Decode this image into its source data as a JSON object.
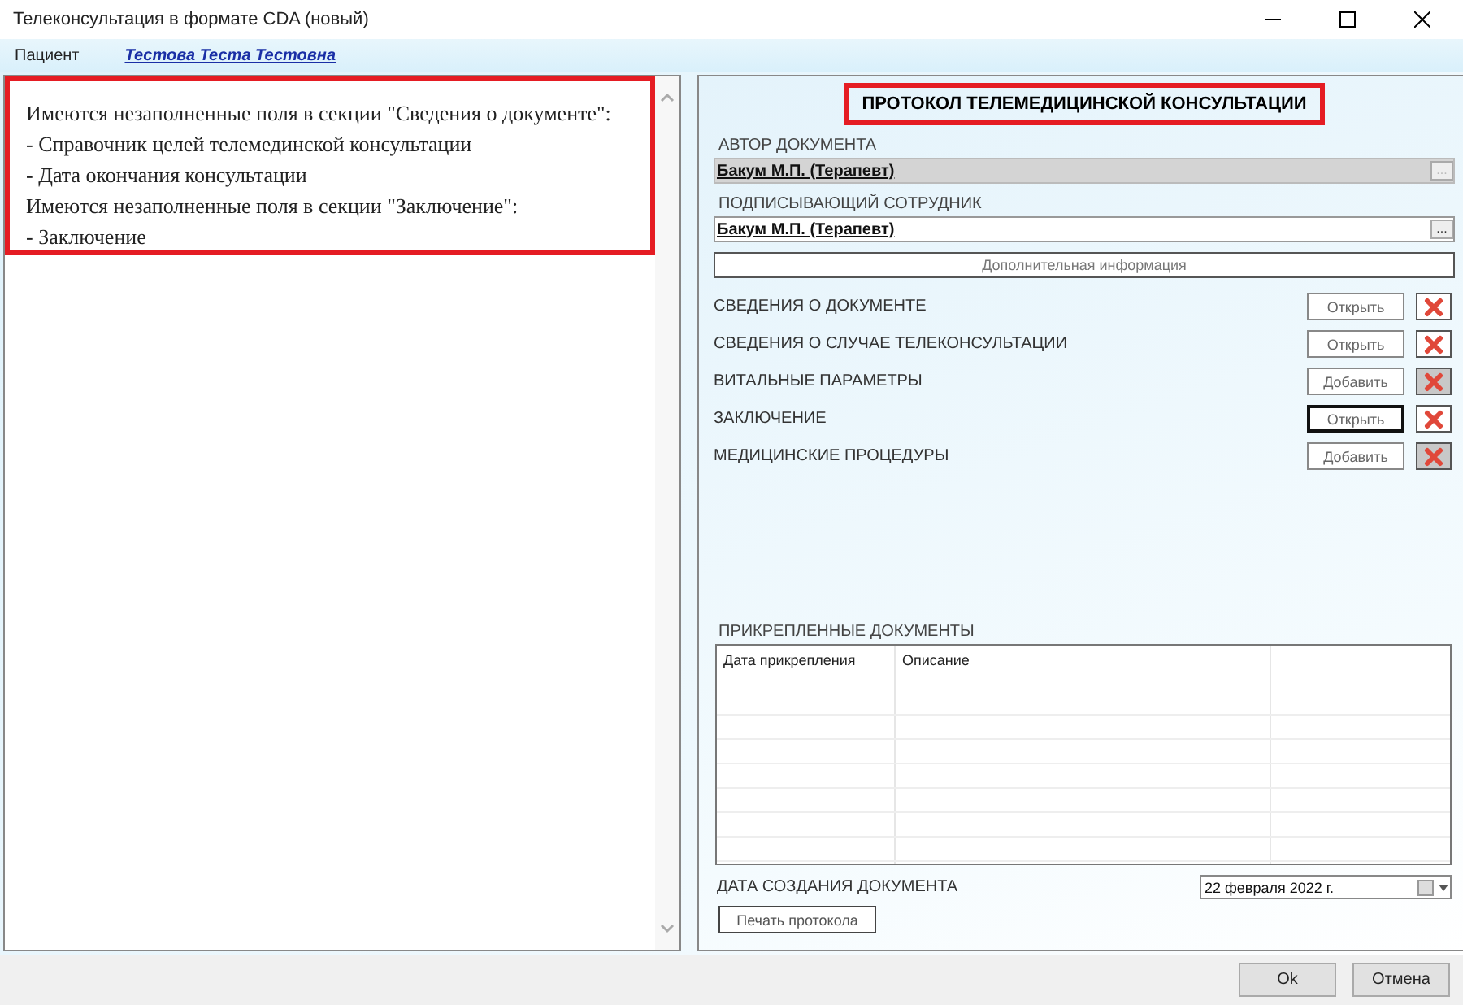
{
  "window": {
    "title": "Телеконсультация в формате CDA (новый)"
  },
  "patient": {
    "label": "Пациент",
    "name": "Тестова Теста Тестовна"
  },
  "messages": [
    "Имеются незаполненные поля в секции \"Сведения о документе\":",
    "- Справочник целей телемединской консультации",
    "- Дата окончания консультации",
    "Имеются незаполненные поля в секции \"Заключение\":",
    "- Заключение"
  ],
  "protocol": {
    "title": "ПРОТОКОЛ ТЕЛЕМЕДИЦИНСКОЙ КОНСУЛЬТАЦИИ",
    "fields": [
      {
        "label": "АВТОР ДОКУМЕНТА",
        "value": "Бакум М.П. (Терапевт)",
        "disabled": true
      },
      {
        "label": "ПОДПИСЫВАЮЩИЙ СОТРУДНИК",
        "value": "Бакум М.П. (Терапевт)",
        "disabled": false
      }
    ],
    "browse_button": "...",
    "extra_button": "Дополнительная информация",
    "sections": [
      {
        "label": "СВЕДЕНИЯ О ДОКУМЕНТЕ",
        "button": "Открыть",
        "focused": false,
        "delete_disabled": false
      },
      {
        "label": "СВЕДЕНИЯ О СЛУЧАЕ ТЕЛЕКОНСУЛЬТАЦИИ",
        "button": "Открыть",
        "focused": false,
        "delete_disabled": false
      },
      {
        "label": "ВИТАЛЬНЫЕ ПАРАМЕТРЫ",
        "button": "Добавить",
        "focused": false,
        "delete_disabled": true
      },
      {
        "label": "ЗАКЛЮЧЕНИЕ",
        "button": "Открыть",
        "focused": true,
        "delete_disabled": false
      },
      {
        "label": "МЕДИЦИНСКИЕ ПРОЦЕДУРЫ",
        "button": "Добавить",
        "focused": false,
        "delete_disabled": true
      }
    ],
    "attachments": {
      "label": "ПРИКРЕПЛЕННЫЕ ДОКУМЕНТЫ",
      "columns": [
        "Дата прикрепления",
        "Описание"
      ]
    },
    "date": {
      "label": "ДАТА СОЗДАНИЯ ДОКУМЕНТА",
      "value": "22 февраля  2022 г."
    },
    "print_button": "Печать протокола"
  },
  "buttons": [
    "Ok",
    "Отмена"
  ]
}
